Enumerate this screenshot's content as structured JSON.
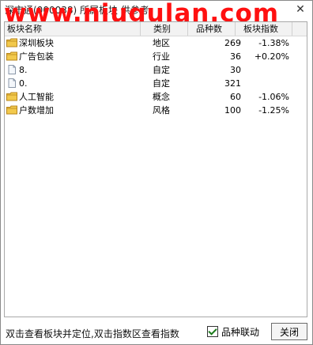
{
  "window": {
    "title": "深市通(000038)  所属板块  供参考",
    "watermark": "www.niugulan.com",
    "close_glyph": "✕"
  },
  "list": {
    "columns": [
      "板块名称",
      "类别",
      "品种数",
      "板块指数"
    ],
    "rows": [
      {
        "icon": "folder-icon",
        "name": "深圳板块",
        "type": "地区",
        "count": "269",
        "index": "-1.38%"
      },
      {
        "icon": "folder-icon",
        "name": "广告包装",
        "type": "行业",
        "count": "36",
        "index": "+0.20%"
      },
      {
        "icon": "document-icon",
        "name": "8.",
        "type": "自定",
        "count": "30",
        "index": ""
      },
      {
        "icon": "document-icon",
        "name": "0.",
        "type": "自定",
        "count": "321",
        "index": ""
      },
      {
        "icon": "folder-icon",
        "name": "人工智能",
        "type": "概念",
        "count": "60",
        "index": "-1.06%"
      },
      {
        "icon": "folder-icon",
        "name": "户数增加",
        "type": "风格",
        "count": "100",
        "index": "-1.25%"
      }
    ]
  },
  "footer": {
    "status": "双击查看板块并定位,双击指数区查看指数",
    "checkbox_label": "品种联动",
    "checkbox_checked": true,
    "close_button": "关闭"
  },
  "colors": {
    "watermark": "#ff1010",
    "folder": "#f2c94c",
    "folder_border": "#b8861c"
  }
}
